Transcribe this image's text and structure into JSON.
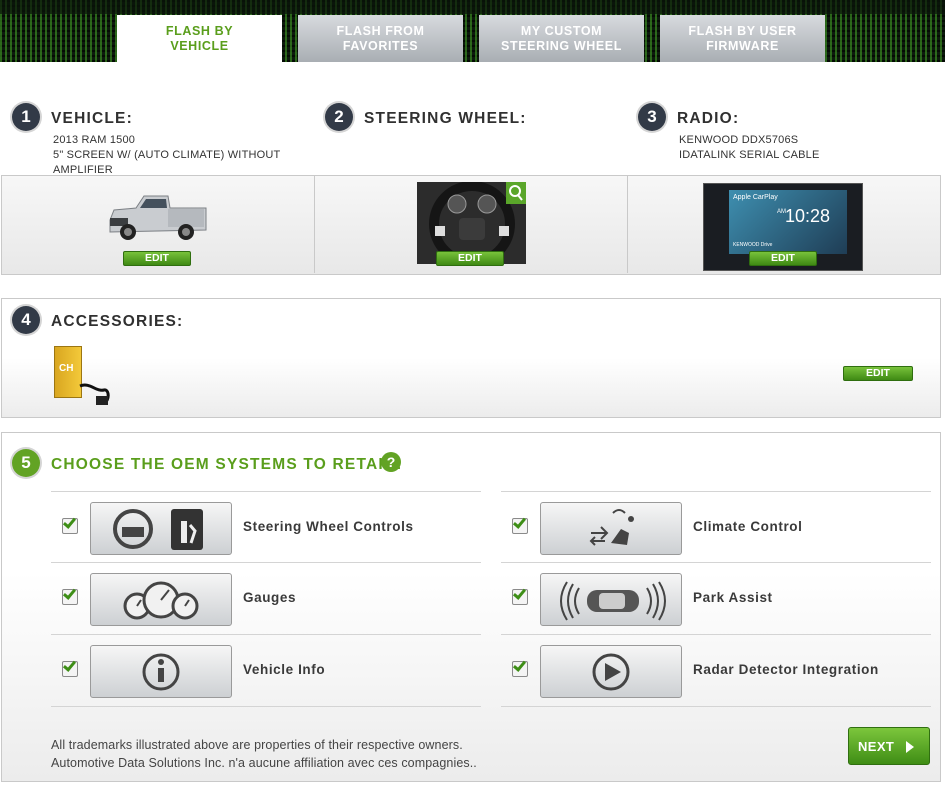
{
  "tabs": [
    {
      "line1": "FLASH BY",
      "line2": "VEHICLE",
      "active": true
    },
    {
      "line1": "FLASH FROM",
      "line2": "FAVORITES",
      "active": false
    },
    {
      "line1": "MY CUSTOM",
      "line2": "STEERING WHEEL",
      "active": false
    },
    {
      "line1": "FLASH BY USER",
      "line2": "FIRMWARE",
      "active": false
    }
  ],
  "vehicle": {
    "number": "1",
    "title": "VEHICLE:",
    "line1": "2013 RAM 1500",
    "line2": "5\" SCREEN W/ (AUTO CLIMATE) WITHOUT",
    "line3": "AMPLIFIER",
    "edit": "EDIT"
  },
  "steering": {
    "number": "2",
    "title": "STEERING WHEEL:",
    "edit": "EDIT"
  },
  "radio": {
    "number": "3",
    "title": "RADIO:",
    "line1": "KENWOOD DDX5706S",
    "line2": "IDATALINK SERIAL CABLE",
    "edit": "EDIT",
    "screen_time": "10:28",
    "screen_ampm": "AM",
    "screen_app": "Apple CarPlay",
    "screen_brand": "KENWOOD Drive"
  },
  "accessories": {
    "number": "4",
    "title": "ACCESSORIES:",
    "edit": "EDIT",
    "box_label": "CH"
  },
  "oem": {
    "number": "5",
    "title": "CHOOSE THE OEM SYSTEMS TO RETAIN:",
    "help": "?",
    "left": [
      {
        "label": "Steering Wheel Controls",
        "checked": true,
        "icon": "steering-wheel-controls-icon"
      },
      {
        "label": "Gauges",
        "checked": true,
        "icon": "gauges-icon"
      },
      {
        "label": "Vehicle Info",
        "checked": true,
        "icon": "info-icon"
      }
    ],
    "right": [
      {
        "label": "Climate Control",
        "checked": true,
        "icon": "climate-icon"
      },
      {
        "label": "Park Assist",
        "checked": true,
        "icon": "park-assist-icon"
      },
      {
        "label": "Radar Detector Integration",
        "checked": true,
        "icon": "play-icon"
      }
    ]
  },
  "footer": {
    "line1": "All trademarks illustrated above are properties of their respective owners.",
    "line2": "Automotive Data Solutions Inc. n'a aucune affiliation avec ces compagnies.."
  },
  "next_label": "NEXT",
  "colors": {
    "accent_green": "#5a9e1c",
    "dark_badge": "#323a47"
  }
}
